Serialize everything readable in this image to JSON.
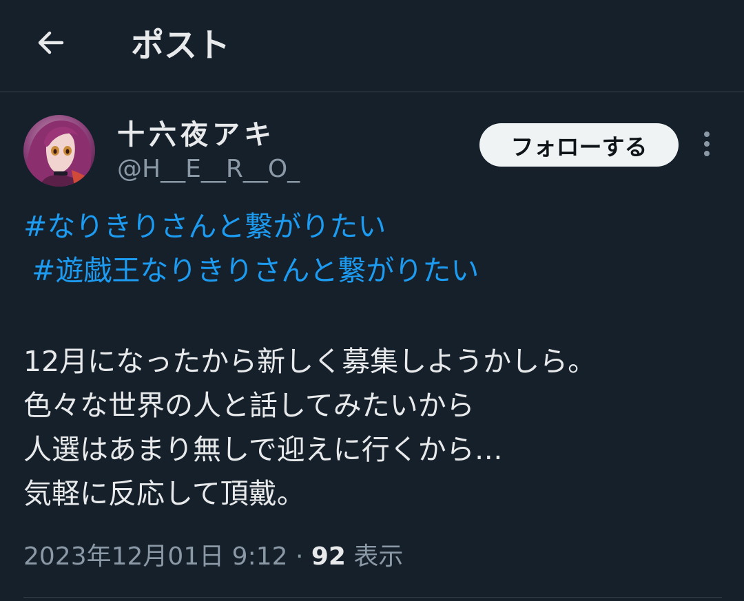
{
  "header": {
    "title": "ポスト",
    "back_icon": "arrow-left-icon"
  },
  "post": {
    "author": {
      "display_name": "十六夜アキ",
      "handle": "@H__E__R__O_"
    },
    "follow_label": "フォローする",
    "more_icon": "more-vertical-icon",
    "hashtags": [
      "#なりきりさんと繋がりたい",
      "#遊戯王なりきりさんと繋がりたい"
    ],
    "body_lines": [
      "12月になったから新しく募集しようかしら。",
      "色々な世界の人と話してみたいから",
      "人選はあまり無しで迎えに行くから…",
      "気軽に反応して頂戴。"
    ],
    "timestamp": "2023年12月01日 9:12",
    "separator": " · ",
    "views_count": "92",
    "views_label": " 表示"
  },
  "colors": {
    "background": "#15202b",
    "text": "#e7e9ea",
    "secondary_text": "#8b98a5",
    "link": "#1d9bf0",
    "divider": "#38444d",
    "follow_button_bg": "#eff3f4",
    "follow_button_text": "#0f1419"
  }
}
